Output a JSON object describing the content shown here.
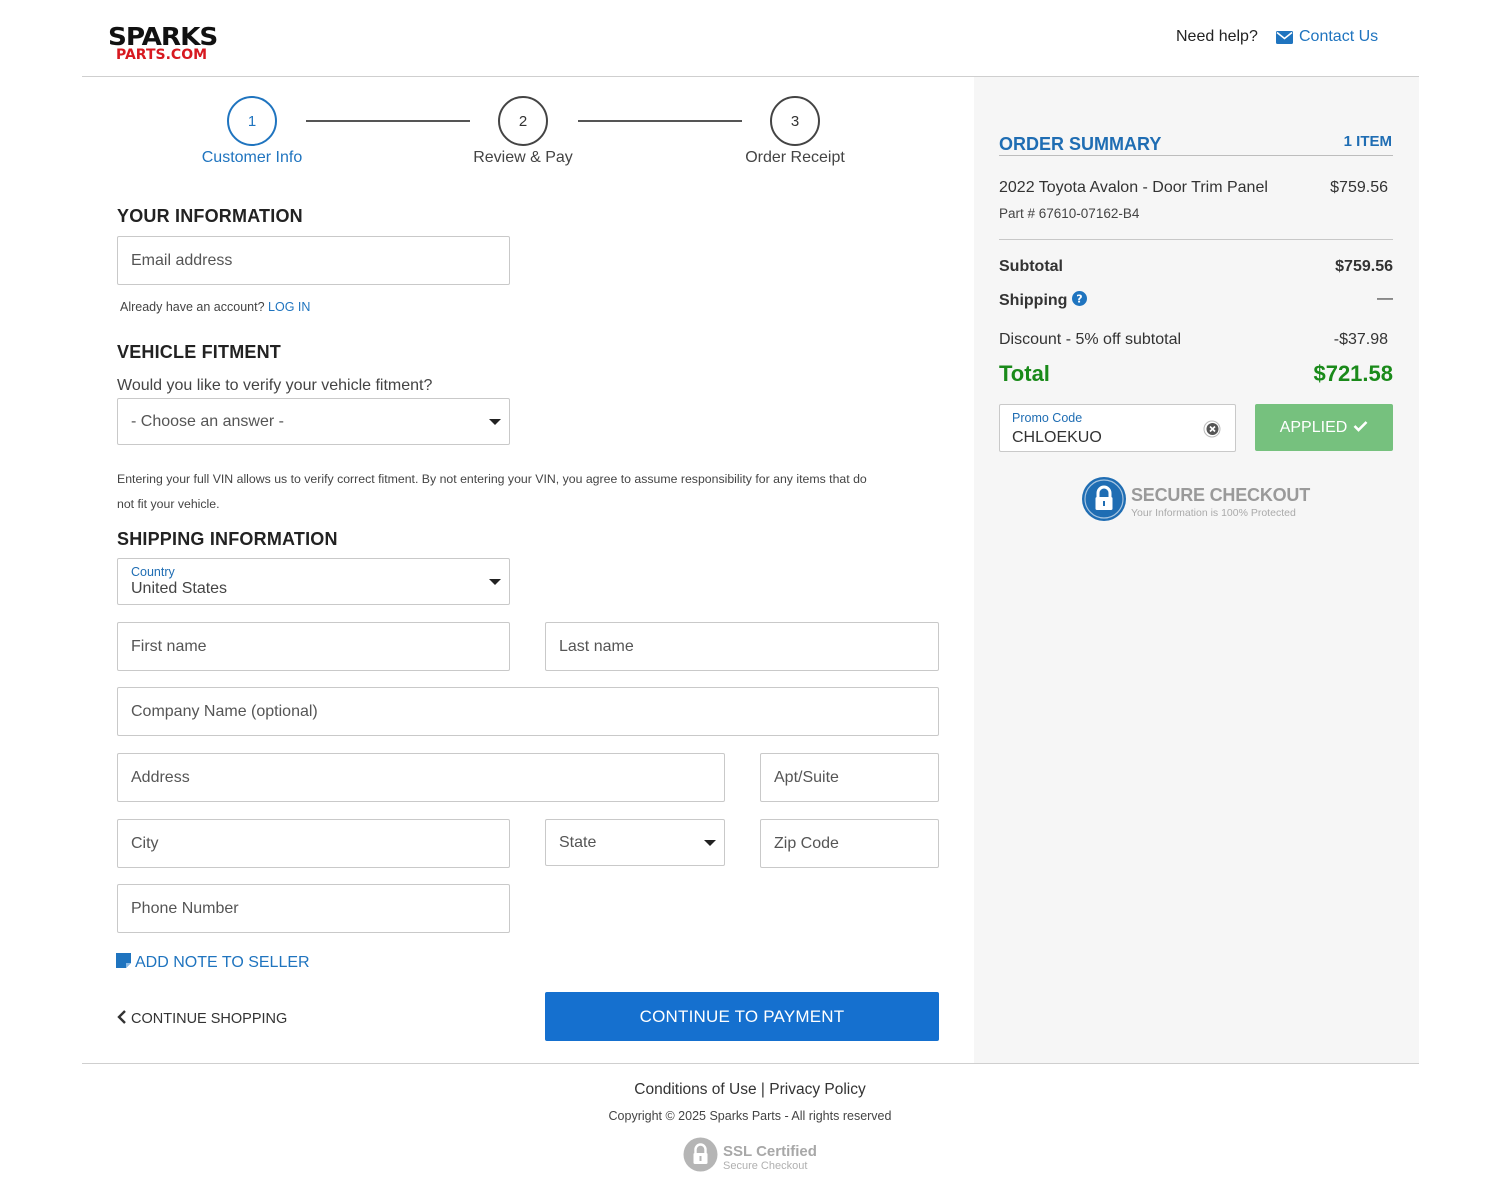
{
  "brand": {
    "line1": "SPARKS",
    "line2": "PARTS.COM"
  },
  "header": {
    "need_help": "Need help?",
    "contact_label": "Contact Us"
  },
  "stepper": [
    {
      "num": "1",
      "label": "Customer Info"
    },
    {
      "num": "2",
      "label": "Review & Pay"
    },
    {
      "num": "3",
      "label": "Order Receipt"
    }
  ],
  "your_info": {
    "title": "YOUR INFORMATION",
    "email_placeholder": "Email address",
    "account_prompt": "Already have an account?",
    "login_label": "LOG IN"
  },
  "fitment": {
    "title": "VEHICLE FITMENT",
    "question": "Would you like to verify your vehicle fitment?",
    "select_value": "- Choose an answer -",
    "note_line1": "Entering your full VIN allows us to verify correct fitment. By not entering your VIN, you agree to assume responsibility for any items that do",
    "note_line2": "not fit your vehicle."
  },
  "shipping": {
    "title": "SHIPPING INFORMATION",
    "country_label": "Country",
    "country_value": "United States",
    "first_name": "First name",
    "last_name": "Last name",
    "company": "Company Name (optional)",
    "address": "Address",
    "apt": "Apt/Suite",
    "city": "City",
    "state": "State",
    "zip": "Zip Code",
    "phone": "Phone Number"
  },
  "actions": {
    "add_note": "ADD NOTE TO SELLER",
    "continue_shopping": "CONTINUE SHOPPING",
    "continue_payment": "CONTINUE TO PAYMENT"
  },
  "summary": {
    "title": "ORDER SUMMARY",
    "item_count": "1 ITEM",
    "item_name": "2022 Toyota Avalon - Door Trim Panel",
    "item_price": "$759.56",
    "item_part": "Part # 67610-07162-B4",
    "subtotal_label": "Subtotal",
    "subtotal_value": "$759.56",
    "shipping_label": "Shipping",
    "shipping_value": "—",
    "discount_label": "Discount - 5% off subtotal",
    "discount_value": "-$37.98",
    "total_label": "Total",
    "total_value": "$721.58",
    "promo_label": "Promo Code",
    "promo_value": "CHLOEKUO",
    "applied_label": "APPLIED",
    "secure_title": "SECURE CHECKOUT",
    "secure_sub": "Your Information is 100% Protected"
  },
  "footer": {
    "conditions": "Conditions of Use",
    "separator": "|",
    "privacy": "Privacy Policy",
    "copyright": "Copyright © 2025 Sparks Parts - All rights reserved",
    "ssl_title": "SSL Certified",
    "ssl_sub": "Secure Checkout"
  },
  "colors": {
    "accent": "#1f74bf",
    "primary_button": "#1570cf",
    "total_green": "#1a8a1a",
    "applied_green": "#76c17e",
    "brand_red": "#d71920"
  }
}
